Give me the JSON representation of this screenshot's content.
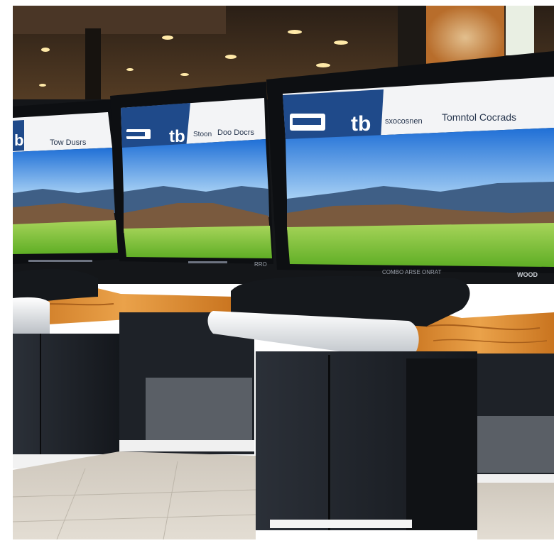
{
  "scene": {
    "description_colors": {
      "ceiling": "#3a2a1c",
      "sky_top": "#1f6fd6",
      "sky_bottom": "#9cc9f2",
      "mountains": "#3f5f86",
      "hills": "#7a5a3e",
      "grass": "#7fc23a",
      "wood": "#d98a2b",
      "cabinet": "#1b1f25",
      "counter_top": "#eef0f2",
      "floor": "#d8d2c8"
    }
  },
  "screens": [
    {
      "brand_logo": "b",
      "header_text": "Tow Dusrs"
    },
    {
      "brand_logo": "tb",
      "header_text": "Doo Docrs",
      "sub_text": "Stoon",
      "footer_text": "RRO"
    },
    {
      "brand_logo": "tb",
      "header_text": "Tomntol Cocrads",
      "sub_text": "sxocosnen",
      "footer_text": "COMBO ARSE ONRAT",
      "footer_right": "WOOD"
    }
  ]
}
